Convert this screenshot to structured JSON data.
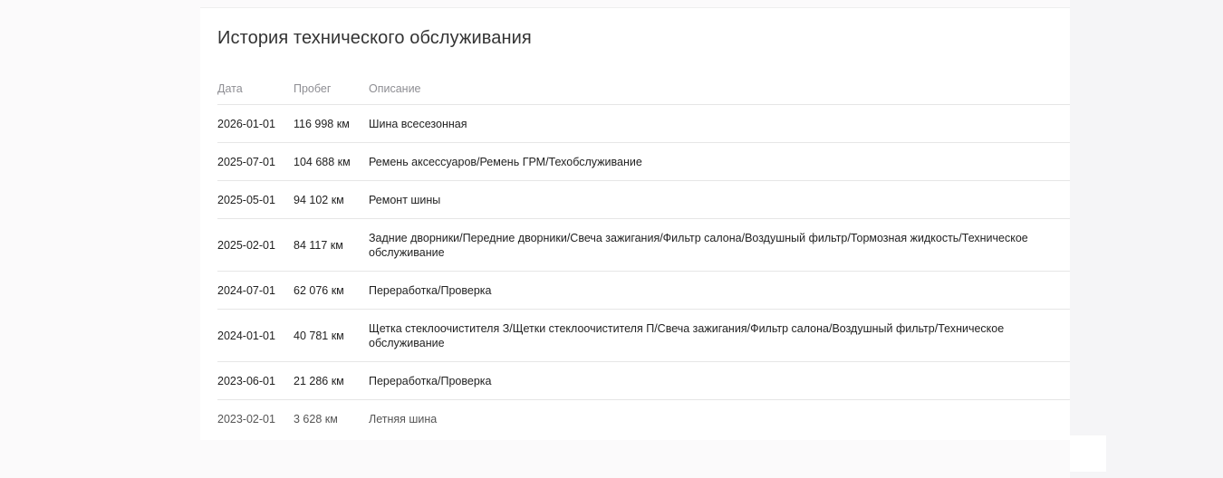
{
  "section": {
    "title": "История технического обслуживания"
  },
  "table": {
    "headers": {
      "date": "Дата",
      "mileage": "Пробег",
      "description": "Описание"
    },
    "rows": [
      {
        "date": "2026-01-01",
        "mileage": "116 998 км",
        "description": "Шина всесезонная"
      },
      {
        "date": "2025-07-01",
        "mileage": "104 688 км",
        "description": "Ремень аксессуаров/Ремень ГРМ/Техобслуживание"
      },
      {
        "date": "2025-05-01",
        "mileage": "94 102 км",
        "description": "Ремонт шины"
      },
      {
        "date": "2025-02-01",
        "mileage": "84 117 км",
        "description": "Задние дворники/Передние дворники/Свеча зажигания/Фильтр салона/Воздушный фильтр/Тормозная жидкость/Техническое обслуживание"
      },
      {
        "date": "2024-07-01",
        "mileage": "62 076 км",
        "description": "Переработка/Проверка"
      },
      {
        "date": "2024-01-01",
        "mileage": "40 781 км",
        "description": "Щетка стеклоочистителя З/Щетки стеклоочистителя П/Свеча зажигания/Фильтр салона/Воздушный фильтр/Техническое обслуживание"
      },
      {
        "date": "2023-06-01",
        "mileage": "21 286 км",
        "description": "Переработка/Проверка"
      },
      {
        "date": "2023-02-01",
        "mileage": "3 628 км",
        "description": "Летняя шина"
      }
    ]
  }
}
